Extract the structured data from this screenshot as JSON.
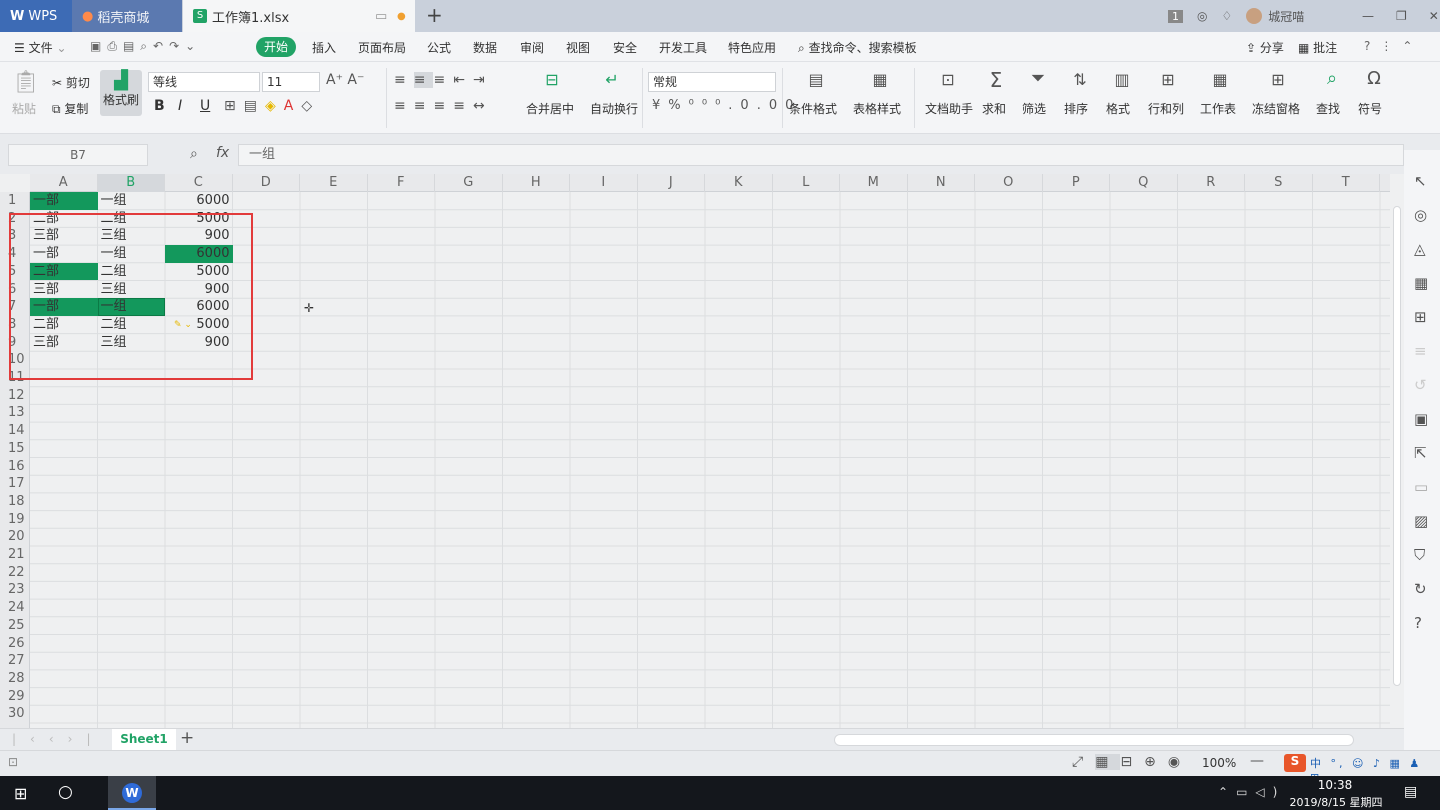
{
  "titlebar": {
    "wps_tab": "WPS",
    "shop_tab": "稻壳商城",
    "doc_tab": "工作簿1.xlsx",
    "new_tab_icon": "+",
    "user_name": "城冠喵",
    "badge": "1"
  },
  "menubar": {
    "file": "文件",
    "start": "开始",
    "items": [
      "插入",
      "页面布局",
      "公式",
      "数据",
      "审阅",
      "视图",
      "安全",
      "开发工具",
      "特色应用"
    ],
    "search": "查找命令、搜索模板",
    "share": "分享",
    "comment": "批注"
  },
  "ribbon": {
    "paste": "粘贴",
    "cut": "剪切",
    "copy": "复制",
    "format_painter": "格式刷",
    "font_name": "等线",
    "font_size": "11",
    "bold": "B",
    "italic": "I",
    "underline": "U",
    "merge_center": "合并居中",
    "wrap_text": "自动换行",
    "number_format": "常规",
    "conditional_format": "条件格式",
    "table_style": "表格样式",
    "doc_helper": "文档助手",
    "sum": "求和",
    "filter": "筛选",
    "sort": "排序",
    "format": "格式",
    "rows_cols": "行和列",
    "worksheet": "工作表",
    "freeze": "冻结窗格",
    "find": "查找",
    "symbol": "符号"
  },
  "formulabar": {
    "name_box": "B7",
    "fx": "fx",
    "content": "一组"
  },
  "columns": [
    "A",
    "B",
    "C",
    "D",
    "E",
    "F",
    "G",
    "H",
    "I",
    "J",
    "K",
    "L",
    "M",
    "N",
    "O",
    "P",
    "Q",
    "R",
    "S",
    "T"
  ],
  "rows": [
    "1",
    "2",
    "3",
    "4",
    "5",
    "6",
    "7",
    "8",
    "9",
    "10",
    "11",
    "12",
    "13",
    "14",
    "15",
    "16",
    "17",
    "18",
    "19",
    "20",
    "21",
    "22",
    "23",
    "24",
    "25",
    "26",
    "27",
    "28",
    "29",
    "30"
  ],
  "grid": [
    {
      "a": "一部",
      "b": "一组",
      "c": "6000"
    },
    {
      "a": "二部",
      "b": "二组",
      "c": "5000"
    },
    {
      "a": "三部",
      "b": "三组",
      "c": "900"
    },
    {
      "a": "一部",
      "b": "一组",
      "c": "6000"
    },
    {
      "a": "二部",
      "b": "二组",
      "c": "5000"
    },
    {
      "a": "三部",
      "b": "三组",
      "c": "900"
    },
    {
      "a": "一部",
      "b": "一组",
      "c": "6000"
    },
    {
      "a": "二部",
      "b": "二组",
      "c": "5000"
    },
    {
      "a": "三部",
      "b": "三组",
      "c": "900"
    }
  ],
  "highlight_color": "#13985c",
  "annotation_color": "#e23b3b",
  "sheettabs": {
    "active": "Sheet1",
    "add": "+"
  },
  "statusbar": {
    "zoom": "100%"
  },
  "taskbar": {
    "time": "10:38",
    "date": "2019/8/15 星期四",
    "ime": "中"
  }
}
